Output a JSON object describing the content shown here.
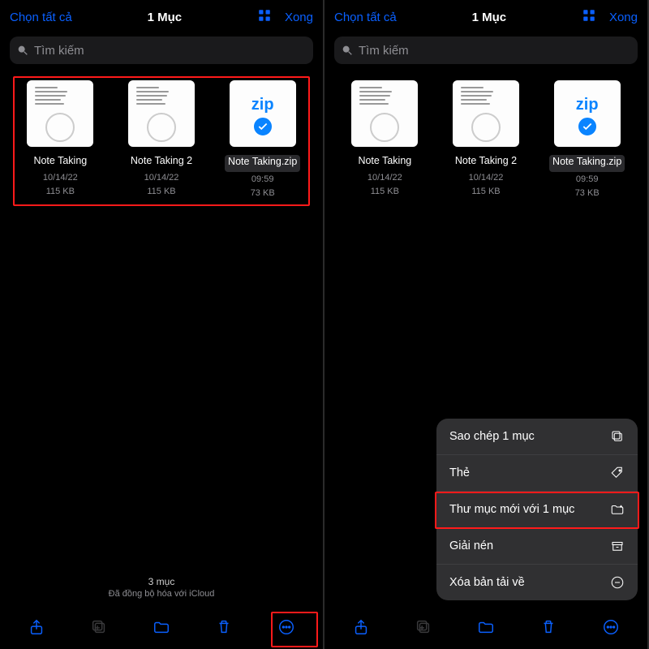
{
  "header": {
    "select_all": "Chọn tất cả",
    "title": "1 Mục",
    "done": "Xong"
  },
  "search": {
    "placeholder": "Tìm kiếm"
  },
  "files": [
    {
      "name": "Note Taking",
      "date": "10/14/22",
      "size": "115 KB",
      "type": "doc"
    },
    {
      "name": "Note Taking 2",
      "date": "10/14/22",
      "size": "115 KB",
      "type": "doc"
    },
    {
      "name": "Note Taking.zip",
      "date": "09:59",
      "size": "73 KB",
      "type": "zip",
      "selected": true,
      "zip_label": "zip"
    }
  ],
  "status": {
    "count": "3 mục",
    "sync": "Đã đồng bộ hóa với iCloud"
  },
  "menu": {
    "copy": "Sao chép 1 mục",
    "tag": "Thẻ",
    "folder": "Thư mục mới với 1 mục",
    "unzip": "Giải nén",
    "remove": "Xóa bản tải về"
  }
}
